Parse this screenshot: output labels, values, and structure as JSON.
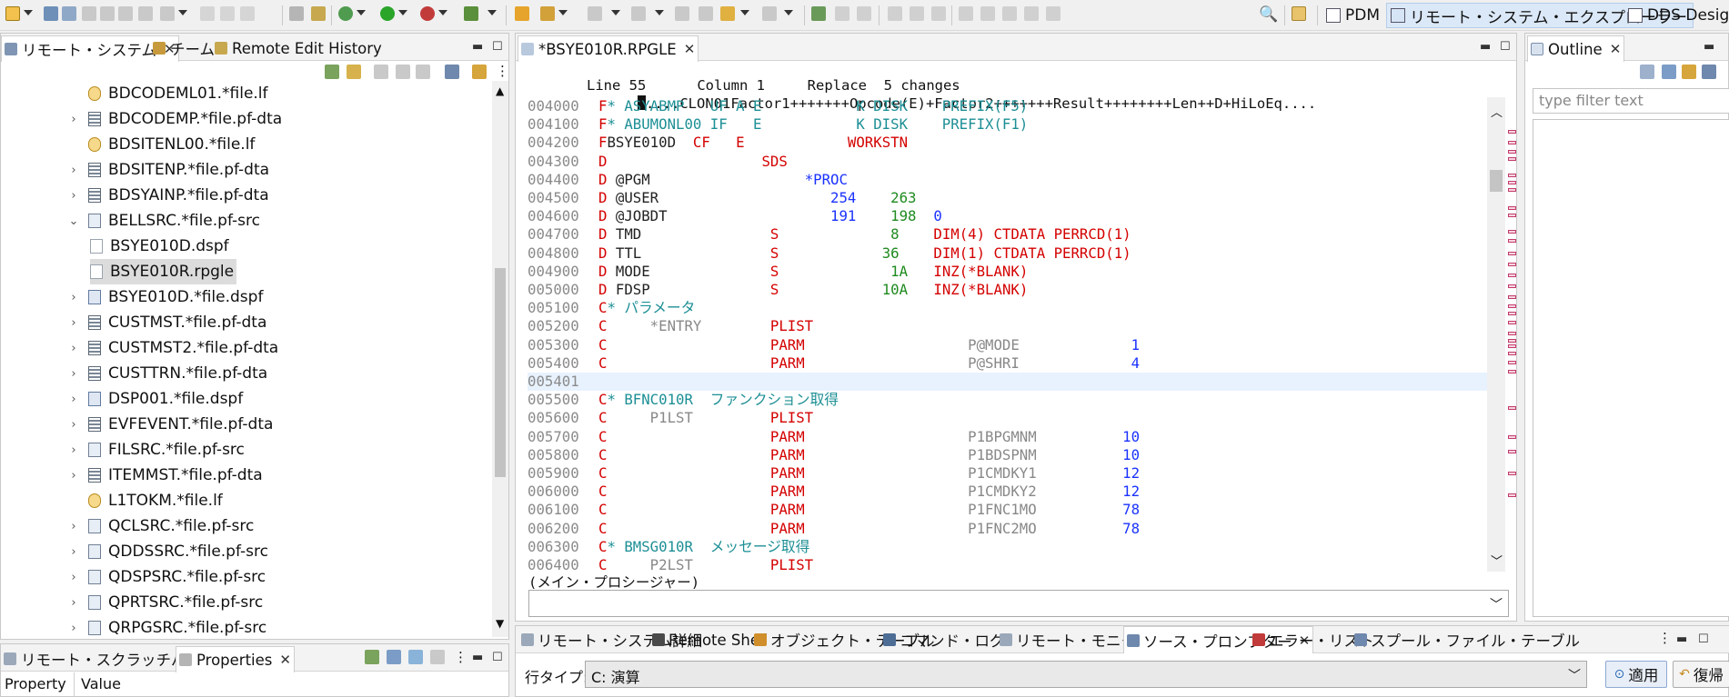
{
  "toolbar": {
    "perspectives": [
      {
        "label": "PDM",
        "active": false
      },
      {
        "label": "リモート・システム・エクスプローラー",
        "active": true
      },
      {
        "label": "DDS Design",
        "active": false
      }
    ]
  },
  "left_panel": {
    "tabs": [
      {
        "label": "リモート・システム",
        "active": true
      },
      {
        "label": "チーム",
        "active": false
      },
      {
        "label": "Remote Edit History",
        "active": false
      }
    ],
    "tree": [
      {
        "label": "BDCODEML01.*file.lf",
        "icon": "logical-file-icon",
        "depth": 1,
        "expander": ""
      },
      {
        "label": "BDCODEMP.*file.pf-dta",
        "icon": "physical-file-icon",
        "depth": 1,
        "expander": ">"
      },
      {
        "label": "BDSITENL00.*file.lf",
        "icon": "logical-file-icon",
        "depth": 1,
        "expander": ""
      },
      {
        "label": "BDSITENP.*file.pf-dta",
        "icon": "physical-file-icon",
        "depth": 1,
        "expander": ">"
      },
      {
        "label": "BDSYAINP.*file.pf-dta",
        "icon": "physical-file-icon",
        "depth": 1,
        "expander": ">"
      },
      {
        "label": "BELLSRC.*file.pf-src",
        "icon": "source-file-icon",
        "depth": 1,
        "expander": "v"
      },
      {
        "label": "BSYE010D.dspf",
        "icon": "member-icon",
        "depth": 2,
        "expander": ""
      },
      {
        "label": "BSYE010R.rpgle",
        "icon": "member-icon",
        "depth": 2,
        "expander": "",
        "selected": true
      },
      {
        "label": "BSYE010D.*file.dspf",
        "icon": "display-file-icon",
        "depth": 1,
        "expander": ">"
      },
      {
        "label": "CUSTMST.*file.pf-dta",
        "icon": "physical-file-icon",
        "depth": 1,
        "expander": ">"
      },
      {
        "label": "CUSTMST2.*file.pf-dta",
        "icon": "physical-file-icon",
        "depth": 1,
        "expander": ">"
      },
      {
        "label": "CUSTTRN.*file.pf-dta",
        "icon": "physical-file-icon",
        "depth": 1,
        "expander": ">"
      },
      {
        "label": "DSP001.*file.dspf",
        "icon": "display-file-icon",
        "depth": 1,
        "expander": ">"
      },
      {
        "label": "EVFEVENT.*file.pf-dta",
        "icon": "physical-file-icon",
        "depth": 1,
        "expander": ">"
      },
      {
        "label": "FILSRC.*file.pf-src",
        "icon": "source-file-icon",
        "depth": 1,
        "expander": ">"
      },
      {
        "label": "ITEMMST.*file.pf-dta",
        "icon": "physical-file-icon",
        "depth": 1,
        "expander": ">"
      },
      {
        "label": "L1TOKM.*file.lf",
        "icon": "logical-file-icon",
        "depth": 1,
        "expander": ""
      },
      {
        "label": "QCLSRC.*file.pf-src",
        "icon": "source-file-icon",
        "depth": 1,
        "expander": ">"
      },
      {
        "label": "QDDSSRC.*file.pf-src",
        "icon": "source-file-icon",
        "depth": 1,
        "expander": ">"
      },
      {
        "label": "QDSPSRC.*file.pf-src",
        "icon": "source-file-icon",
        "depth": 1,
        "expander": ">"
      },
      {
        "label": "QPRTSRC.*file.pf-src",
        "icon": "source-file-icon",
        "depth": 1,
        "expander": ">"
      },
      {
        "label": "QRPGSRC.*file.pf-src",
        "icon": "source-file-icon",
        "depth": 1,
        "expander": ">"
      }
    ]
  },
  "bottom_left_panel": {
    "tabs": [
      {
        "label": "リモート・スクラッチパッド",
        "active": false
      },
      {
        "label": "Properties",
        "active": true
      }
    ],
    "columns": [
      "Property",
      "Value"
    ]
  },
  "editor": {
    "tab_label": "*BSYE010R.RPGLE",
    "status": {
      "line": "Line 55",
      "column": "Column 1",
      "mode": "Replace",
      "changes": "5 changes"
    },
    "ruler": "....CLON01Factor1+++++++Opcode(E)+Factor2+++++++Result++++++++Len++D+HiLoEq....",
    "lines": [
      {
        "seq": "004000",
        "segs": [
          {
            "t": "F",
            "c": "red"
          },
          {
            "t": "* ASYABMP   UF A E           K DISK    PREFIX(F5)",
            "c": "teal"
          }
        ]
      },
      {
        "seq": "004100",
        "segs": [
          {
            "t": "F",
            "c": "red"
          },
          {
            "t": "* ABUMONL00 IF   E           K DISK    PREFIX(F1)",
            "c": "teal"
          }
        ]
      },
      {
        "seq": "004200",
        "segs": [
          {
            "t": "F",
            "c": "red"
          },
          {
            "t": "BSYE010D  ",
            "c": "black"
          },
          {
            "t": "CF   E            WORKSTN",
            "c": "red"
          }
        ]
      },
      {
        "seq": "004300",
        "segs": [
          {
            "t": "D",
            "c": "red"
          },
          {
            "t": "                  ",
            "c": "black"
          },
          {
            "t": "SDS",
            "c": "red"
          }
        ]
      },
      {
        "seq": "004400",
        "segs": [
          {
            "t": "D",
            "c": "red"
          },
          {
            "t": " @PGM                  ",
            "c": "black"
          },
          {
            "t": "*PROC",
            "c": "blue"
          }
        ]
      },
      {
        "seq": "004500",
        "segs": [
          {
            "t": "D",
            "c": "red"
          },
          {
            "t": " @USER                    ",
            "c": "black"
          },
          {
            "t": "254",
            "c": "blue"
          },
          {
            "t": "    ",
            "c": "black"
          },
          {
            "t": "263",
            "c": "green"
          }
        ]
      },
      {
        "seq": "004600",
        "segs": [
          {
            "t": "D",
            "c": "red"
          },
          {
            "t": " @JOBDT                   ",
            "c": "black"
          },
          {
            "t": "191",
            "c": "blue"
          },
          {
            "t": "    ",
            "c": "black"
          },
          {
            "t": "198",
            "c": "green"
          },
          {
            "t": "  0",
            "c": "blue"
          }
        ]
      },
      {
        "seq": "004700",
        "segs": [
          {
            "t": "D",
            "c": "red"
          },
          {
            "t": " TMD               ",
            "c": "black"
          },
          {
            "t": "S",
            "c": "red"
          },
          {
            "t": "             ",
            "c": "black"
          },
          {
            "t": "8",
            "c": "green"
          },
          {
            "t": "    ",
            "c": "black"
          },
          {
            "t": "DIM(4) CTDATA PERRCD(1)",
            "c": "red"
          }
        ]
      },
      {
        "seq": "004800",
        "segs": [
          {
            "t": "D",
            "c": "red"
          },
          {
            "t": " TTL               ",
            "c": "black"
          },
          {
            "t": "S",
            "c": "red"
          },
          {
            "t": "            ",
            "c": "black"
          },
          {
            "t": "36",
            "c": "green"
          },
          {
            "t": "    ",
            "c": "black"
          },
          {
            "t": "DIM(1) CTDATA PERRCD(1)",
            "c": "red"
          }
        ]
      },
      {
        "seq": "004900",
        "segs": [
          {
            "t": "D",
            "c": "red"
          },
          {
            "t": " MODE              ",
            "c": "black"
          },
          {
            "t": "S",
            "c": "red"
          },
          {
            "t": "             ",
            "c": "black"
          },
          {
            "t": "1A",
            "c": "green"
          },
          {
            "t": "   ",
            "c": "black"
          },
          {
            "t": "INZ(*BLANK)",
            "c": "red"
          }
        ]
      },
      {
        "seq": "005000",
        "segs": [
          {
            "t": "D",
            "c": "red"
          },
          {
            "t": " FDSP              ",
            "c": "black"
          },
          {
            "t": "S",
            "c": "red"
          },
          {
            "t": "            ",
            "c": "black"
          },
          {
            "t": "10A",
            "c": "green"
          },
          {
            "t": "   ",
            "c": "black"
          },
          {
            "t": "INZ(*BLANK)",
            "c": "red"
          }
        ]
      },
      {
        "seq": "005100",
        "segs": [
          {
            "t": "C",
            "c": "red"
          },
          {
            "t": "* パラメータ",
            "c": "teal"
          }
        ]
      },
      {
        "seq": "005200",
        "segs": [
          {
            "t": "C",
            "c": "red"
          },
          {
            "t": "     *ENTRY        ",
            "c": "gray"
          },
          {
            "t": "PLIST",
            "c": "red"
          }
        ]
      },
      {
        "seq": "005300",
        "segs": [
          {
            "t": "C",
            "c": "red"
          },
          {
            "t": "                   ",
            "c": "black"
          },
          {
            "t": "PARM",
            "c": "red"
          },
          {
            "t": "                   ",
            "c": "black"
          },
          {
            "t": "P@MODE",
            "c": "gray"
          },
          {
            "t": "             ",
            "c": "black"
          },
          {
            "t": "1",
            "c": "blue"
          }
        ]
      },
      {
        "seq": "005400",
        "segs": [
          {
            "t": "C",
            "c": "red"
          },
          {
            "t": "                   ",
            "c": "black"
          },
          {
            "t": "PARM",
            "c": "red"
          },
          {
            "t": "                   ",
            "c": "black"
          },
          {
            "t": "P@SHRI",
            "c": "gray"
          },
          {
            "t": "             ",
            "c": "black"
          },
          {
            "t": "4",
            "c": "blue"
          }
        ]
      },
      {
        "seq": "005401",
        "segs": [],
        "current": true
      },
      {
        "seq": "005500",
        "segs": [
          {
            "t": "C",
            "c": "red"
          },
          {
            "t": "* BFNC010R  ファンクション取得",
            "c": "teal"
          }
        ]
      },
      {
        "seq": "005600",
        "segs": [
          {
            "t": "C",
            "c": "red"
          },
          {
            "t": "     P1LST         ",
            "c": "gray"
          },
          {
            "t": "PLIST",
            "c": "red"
          }
        ]
      },
      {
        "seq": "005700",
        "segs": [
          {
            "t": "C",
            "c": "red"
          },
          {
            "t": "                   ",
            "c": "black"
          },
          {
            "t": "PARM",
            "c": "red"
          },
          {
            "t": "                   ",
            "c": "black"
          },
          {
            "t": "P1BPGMNM",
            "c": "gray"
          },
          {
            "t": "          ",
            "c": "black"
          },
          {
            "t": "10",
            "c": "blue"
          }
        ]
      },
      {
        "seq": "005800",
        "segs": [
          {
            "t": "C",
            "c": "red"
          },
          {
            "t": "                   ",
            "c": "black"
          },
          {
            "t": "PARM",
            "c": "red"
          },
          {
            "t": "                   ",
            "c": "black"
          },
          {
            "t": "P1BDSPNM",
            "c": "gray"
          },
          {
            "t": "          ",
            "c": "black"
          },
          {
            "t": "10",
            "c": "blue"
          }
        ]
      },
      {
        "seq": "005900",
        "segs": [
          {
            "t": "C",
            "c": "red"
          },
          {
            "t": "                   ",
            "c": "black"
          },
          {
            "t": "PARM",
            "c": "red"
          },
          {
            "t": "                   ",
            "c": "black"
          },
          {
            "t": "P1CMDKY1",
            "c": "gray"
          },
          {
            "t": "          ",
            "c": "black"
          },
          {
            "t": "12",
            "c": "blue"
          }
        ]
      },
      {
        "seq": "006000",
        "segs": [
          {
            "t": "C",
            "c": "red"
          },
          {
            "t": "                   ",
            "c": "black"
          },
          {
            "t": "PARM",
            "c": "red"
          },
          {
            "t": "                   ",
            "c": "black"
          },
          {
            "t": "P1CMDKY2",
            "c": "gray"
          },
          {
            "t": "          ",
            "c": "black"
          },
          {
            "t": "12",
            "c": "blue"
          }
        ]
      },
      {
        "seq": "006100",
        "segs": [
          {
            "t": "C",
            "c": "red"
          },
          {
            "t": "                   ",
            "c": "black"
          },
          {
            "t": "PARM",
            "c": "red"
          },
          {
            "t": "                   ",
            "c": "black"
          },
          {
            "t": "P1FNC1MO",
            "c": "gray"
          },
          {
            "t": "          ",
            "c": "black"
          },
          {
            "t": "78",
            "c": "blue"
          }
        ]
      },
      {
        "seq": "006200",
        "segs": [
          {
            "t": "C",
            "c": "red"
          },
          {
            "t": "                   ",
            "c": "black"
          },
          {
            "t": "PARM",
            "c": "red"
          },
          {
            "t": "                   ",
            "c": "black"
          },
          {
            "t": "P1FNC2MO",
            "c": "gray"
          },
          {
            "t": "          ",
            "c": "black"
          },
          {
            "t": "78",
            "c": "blue"
          }
        ]
      },
      {
        "seq": "006300",
        "segs": [
          {
            "t": "C",
            "c": "red"
          },
          {
            "t": "* BMSG010R  メッセージ取得",
            "c": "teal"
          }
        ]
      },
      {
        "seq": "006400",
        "segs": [
          {
            "t": "C",
            "c": "red"
          },
          {
            "t": "     P2LST         ",
            "c": "gray"
          },
          {
            "t": "PLIST",
            "c": "red"
          }
        ]
      }
    ],
    "procedure_label": "(メイン・プロシージャー)",
    "procedure_combo_value": ""
  },
  "outline": {
    "tab_label": "Outline",
    "filter_placeholder": "type filter text"
  },
  "bottom_panel": {
    "tabs": [
      {
        "label": "リモート・システム詳細",
        "active": false
      },
      {
        "label": "Remote Shell",
        "active": false
      },
      {
        "label": "オブジェクト・テーブル",
        "active": false
      },
      {
        "label": "コマンド・ログ",
        "active": false
      },
      {
        "label": "リモート・モニター",
        "active": false
      },
      {
        "label": "ソース・プロンプター",
        "active": true
      },
      {
        "label": "エラー・リスト",
        "active": false
      },
      {
        "label": "スプール・ファイル・テーブル",
        "active": false
      }
    ],
    "line_type_label": "行タイプ:",
    "line_type_value": "C: 演算",
    "apply_label": "適用",
    "restore_label": "復帰"
  },
  "colors": {
    "red": "#d40000",
    "blue": "#1a32ff",
    "teal": "#1c8f95",
    "green": "#1f8a1f",
    "current_line": "#e8f2fe",
    "selection": "#dcdcdc",
    "active_perspective": "#dbe8f7"
  }
}
